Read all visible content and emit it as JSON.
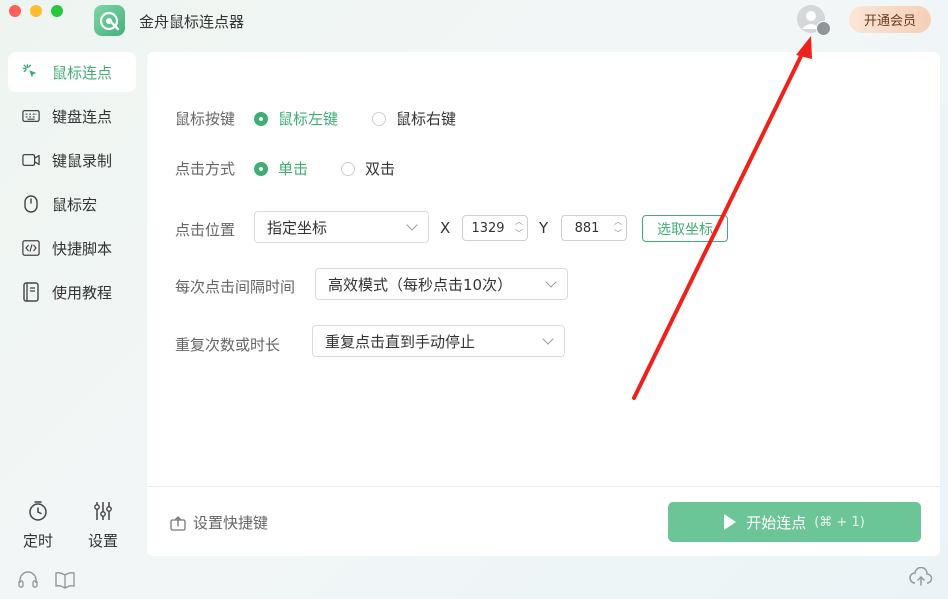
{
  "app": {
    "title": "金舟鼠标连点器",
    "vip_button": "开通会员"
  },
  "sidebar": {
    "items": [
      {
        "label": "鼠标连点",
        "icon": "mouse-click-icon",
        "active": true
      },
      {
        "label": "键盘连点",
        "icon": "keyboard-icon",
        "active": false
      },
      {
        "label": "键鼠录制",
        "icon": "record-icon",
        "active": false
      },
      {
        "label": "鼠标宏",
        "icon": "mouse-icon",
        "active": false
      },
      {
        "label": "快捷脚本",
        "icon": "code-icon",
        "active": false
      },
      {
        "label": "使用教程",
        "icon": "book-icon",
        "active": false
      }
    ],
    "bottom": {
      "timer_label": "定时",
      "settings_label": "设置"
    }
  },
  "form": {
    "mouse_button": {
      "label": "鼠标按键",
      "options": [
        "鼠标左键",
        "鼠标右键"
      ],
      "selected": "鼠标左键"
    },
    "click_type": {
      "label": "点击方式",
      "options": [
        "单击",
        "双击"
      ],
      "selected": "单击"
    },
    "position": {
      "label": "点击位置",
      "mode": "指定坐标",
      "x_label": "X",
      "x_value": "1329",
      "y_label": "Y",
      "y_value": "881",
      "pick_button": "选取坐标"
    },
    "interval": {
      "label": "每次点击间隔时间",
      "value": "高效模式（每秒点击10次）"
    },
    "repeat": {
      "label": "重复次数或时长",
      "value": "重复点击直到手动停止"
    }
  },
  "footer": {
    "shortcut_label": "设置快捷键",
    "start_label": "开始连点",
    "start_hint": "(⌘ + 1)"
  },
  "colors": {
    "accent": "#3fae74",
    "start_button": "#6cc596",
    "annotation_arrow": "#f0201a"
  }
}
